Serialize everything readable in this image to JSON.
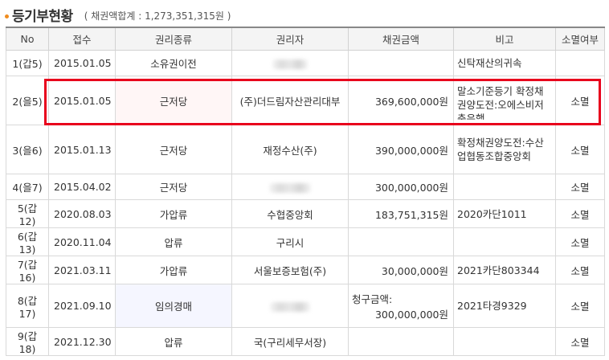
{
  "header": {
    "title": "등기부현황",
    "total_label": "( 채권액합계 : 1,273,351,315원 )"
  },
  "columns": [
    "No",
    "접수",
    "권리종류",
    "권리자",
    "채권금액",
    "비고",
    "소멸여부"
  ],
  "rows": [
    {
      "no": "1(갑5)",
      "date": "2015.01.05",
      "type": "소유권이전",
      "holder": "",
      "holder_redacted": true,
      "amount": "",
      "note": "신탁재산의귀속",
      "status": ""
    },
    {
      "no": "2(을5)",
      "date": "2015.01.05",
      "type": "근저당",
      "holder": "(주)더드림자산관리대부",
      "holder_redacted": false,
      "amount": "369,600,000원",
      "note": "말소기준등기 확정채권양도전:오에스비저축은행",
      "status": "소멸"
    },
    {
      "no": "3(을6)",
      "date": "2015.01.13",
      "type": "근저당",
      "holder": "재정수산(주)",
      "holder_redacted": false,
      "amount": "390,000,000원",
      "note": "확정채권양도전:수산업협동조합중앙회",
      "status": "소멸"
    },
    {
      "no": "4(을7)",
      "date": "2015.04.02",
      "type": "근저당",
      "holder": "",
      "holder_redacted": true,
      "amount": "300,000,000원",
      "note": "",
      "status": "소멸"
    },
    {
      "no": "5(갑12)",
      "date": "2020.08.03",
      "type": "가압류",
      "holder": "수협중앙회",
      "holder_redacted": false,
      "amount": "183,751,315원",
      "note": "2020카단1011",
      "status": "소멸"
    },
    {
      "no": "6(갑13)",
      "date": "2020.11.04",
      "type": "압류",
      "holder": "구리시",
      "holder_redacted": false,
      "amount": "",
      "note": "",
      "status": "소멸"
    },
    {
      "no": "7(갑16)",
      "date": "2021.03.11",
      "type": "가압류",
      "holder": "서울보증보험(주)",
      "holder_redacted": false,
      "amount": "30,000,000원",
      "note": "2021카단803344",
      "status": "소멸"
    },
    {
      "no": "8(갑17)",
      "date": "2021.09.10",
      "type": "임의경매",
      "holder": "",
      "holder_redacted": true,
      "amount_label": "청구금액:",
      "amount": "300,000,000원",
      "note": "2021타경9329",
      "status": "소멸"
    },
    {
      "no": "9(갑18)",
      "date": "2021.12.30",
      "type": "압류",
      "holder": "국(구리세무서장)",
      "holder_redacted": false,
      "amount": "",
      "note": "",
      "status": "소멸"
    }
  ],
  "colors": {
    "bullet": "#f08c1e",
    "highlight": "#e8001c",
    "header_bg": "#f4f4f4"
  }
}
